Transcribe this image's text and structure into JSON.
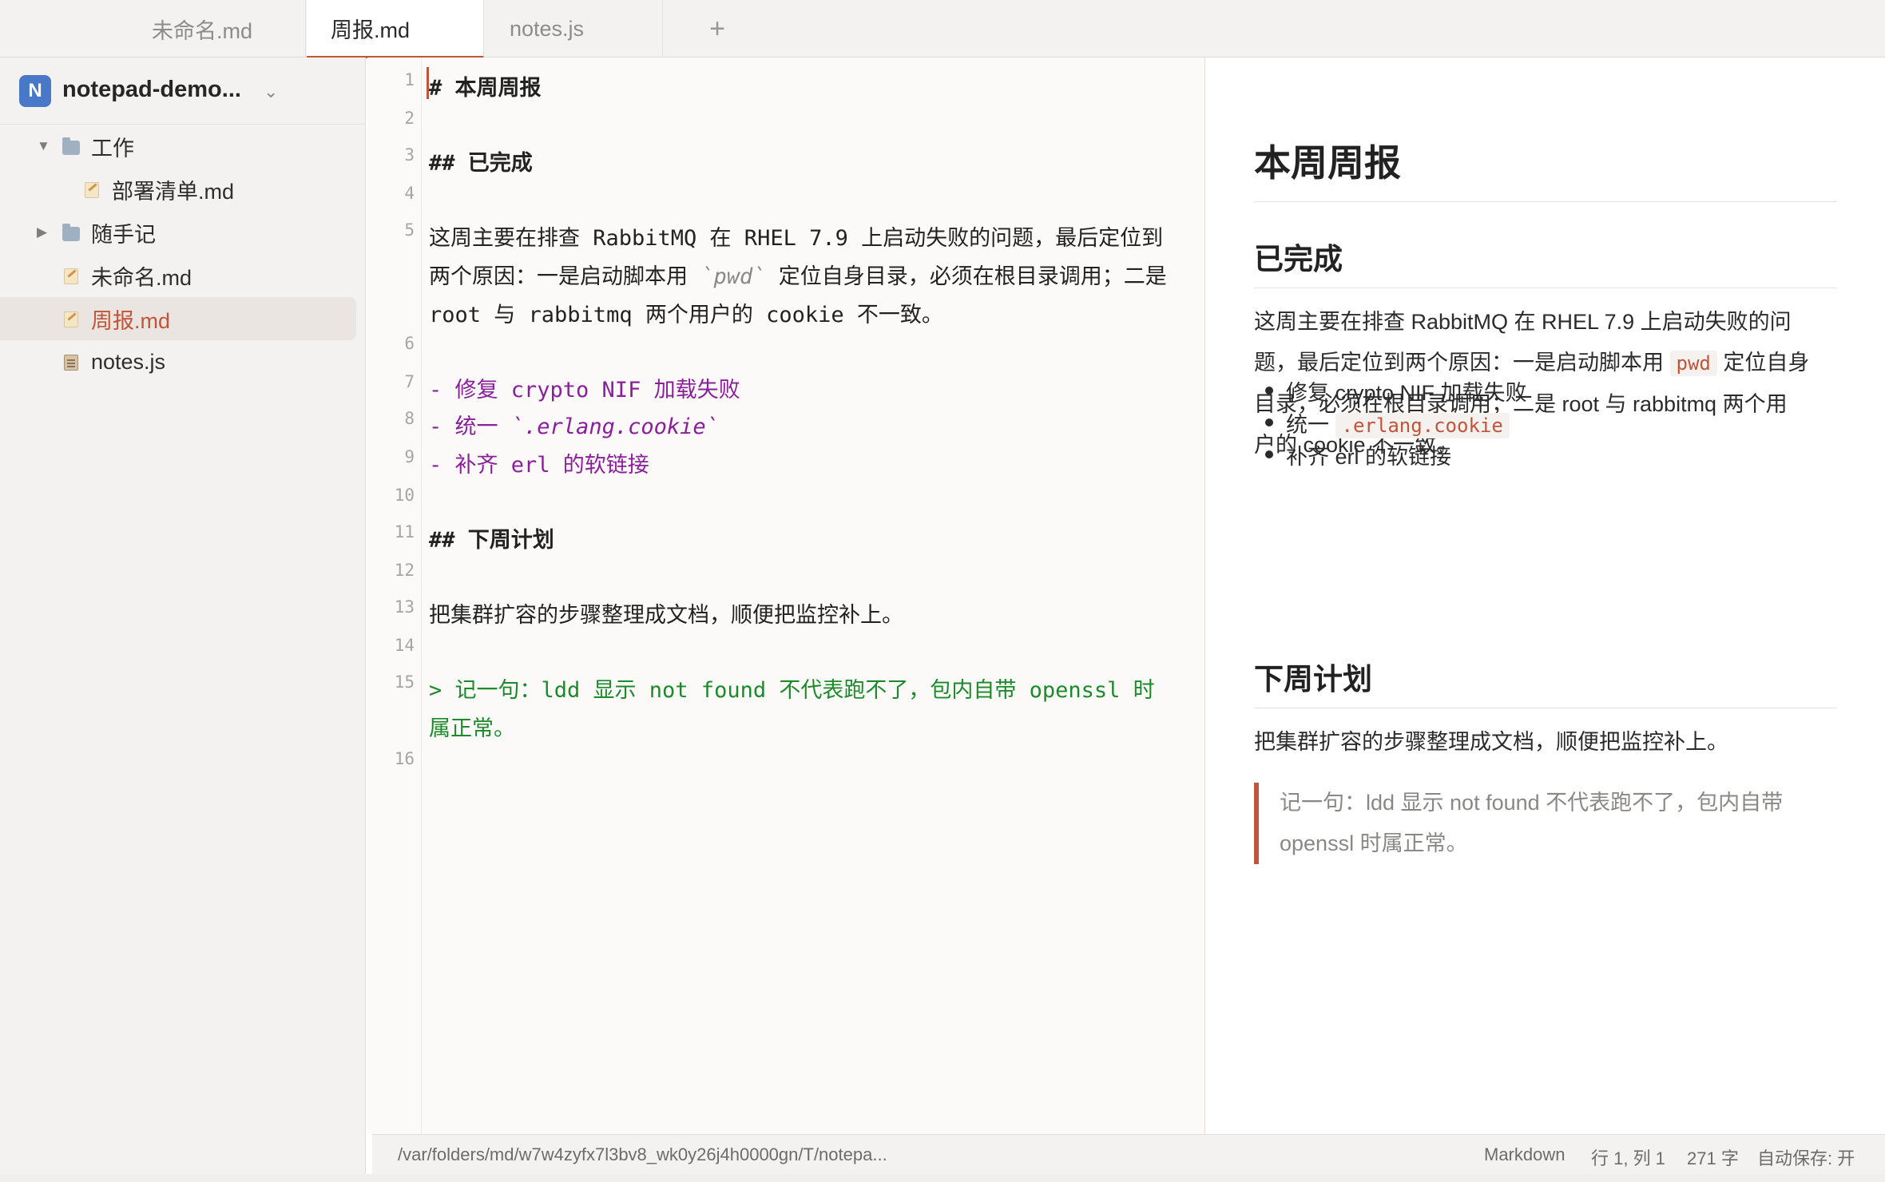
{
  "tabs": [
    {
      "label": "未命名.md",
      "active": false
    },
    {
      "label": "周报.md",
      "active": true
    },
    {
      "label": "notes.js",
      "active": false
    }
  ],
  "tab_add_label": "+",
  "sidebar": {
    "workspace_badge": "N",
    "workspace_name": "notepad-demo...",
    "workspace_chevron": "chevron-down-icon",
    "tree": [
      {
        "label": "工作",
        "type": "folder",
        "expanded": true
      },
      {
        "label": "部署清单.md",
        "type": "markdown"
      },
      {
        "label": "随手记",
        "type": "folder",
        "expanded": false
      },
      {
        "label": "未命名.md",
        "type": "markdown"
      },
      {
        "label": "周报.md",
        "type": "markdown",
        "selected": true
      },
      {
        "label": "notes.js",
        "type": "javascript"
      }
    ]
  },
  "editor": {
    "line_numbers": [
      "1",
      "2",
      "3",
      "4",
      "5",
      "6",
      "7",
      "8",
      "9",
      "10",
      "11",
      "12",
      "13",
      "14",
      "15",
      "16"
    ],
    "lines": {
      "l1": "#  本周周报",
      "l3": "##  已完成",
      "l5a": "这周主要在排查 RabbitMQ 在 RHEL 7.9 上启动失败的问题，最后定位到",
      "l5b_pre": "两个原因：一是启动脚本用 ",
      "l5b_code": "`pwd`",
      "l5b_post": " 定位自身目录，必须在根目录调用；二是",
      "l5c": "root 与 rabbitmq 两个用户的 cookie 不一致。",
      "l7": "- 修复 crypto NIF 加载失败",
      "l8_pre": "- 统一 ",
      "l8_em": "`.erlang.cookie`",
      "l9": "- 补齐 erl 的软链接",
      "l11": "##  下周计划",
      "l13": "把集群扩容的步骤整理成文档，顺便把监控补上。",
      "l15a": "> 记一句：ldd 显示 not found 不代表跑不了，包内自带 openssl 时",
      "l15b": "属正常。"
    }
  },
  "preview": {
    "h1": "本周周报",
    "h2_done": "已完成",
    "p1_a": "这周主要在排查 RabbitMQ 在 RHEL 7.9 上启动失败的问",
    "p1_b_pre": "题，最后定位到两个原因：一是启动脚本用 ",
    "p1_b_code": "pwd",
    "p1_b_post": " 定位自身",
    "p1_c": "目录，必须在根目录调用；二是 root 与 rabbitmq 两个用",
    "p1_d": "户的 cookie 不一致。",
    "list": [
      "修复 crypto NIF 加载失败",
      "统一 ",
      "补齐 erl 的软链接"
    ],
    "list_code": ".erlang.cookie",
    "h2_next": "下周计划",
    "p2": "把集群扩容的步骤整理成文档，顺便把监控补上。",
    "quote_a": "记一句：ldd 显示 not found 不代表跑不了，包内自带",
    "quote_b": "openssl 时属正常。"
  },
  "statusbar": {
    "path": "/var/folders/md/w7w4zyfx7l3bv8_wk0y26j4h0000gn/T/notepa...",
    "language": "Markdown",
    "cursor": "行 1, 列 1",
    "char_count": "271 字",
    "autosave": "自动保存: 开"
  },
  "colors": {
    "accent": "#c0553a",
    "list_color": "#8b1f9b",
    "quote_color": "#1c8a2a",
    "workspace_badge": "#4a78c8"
  }
}
